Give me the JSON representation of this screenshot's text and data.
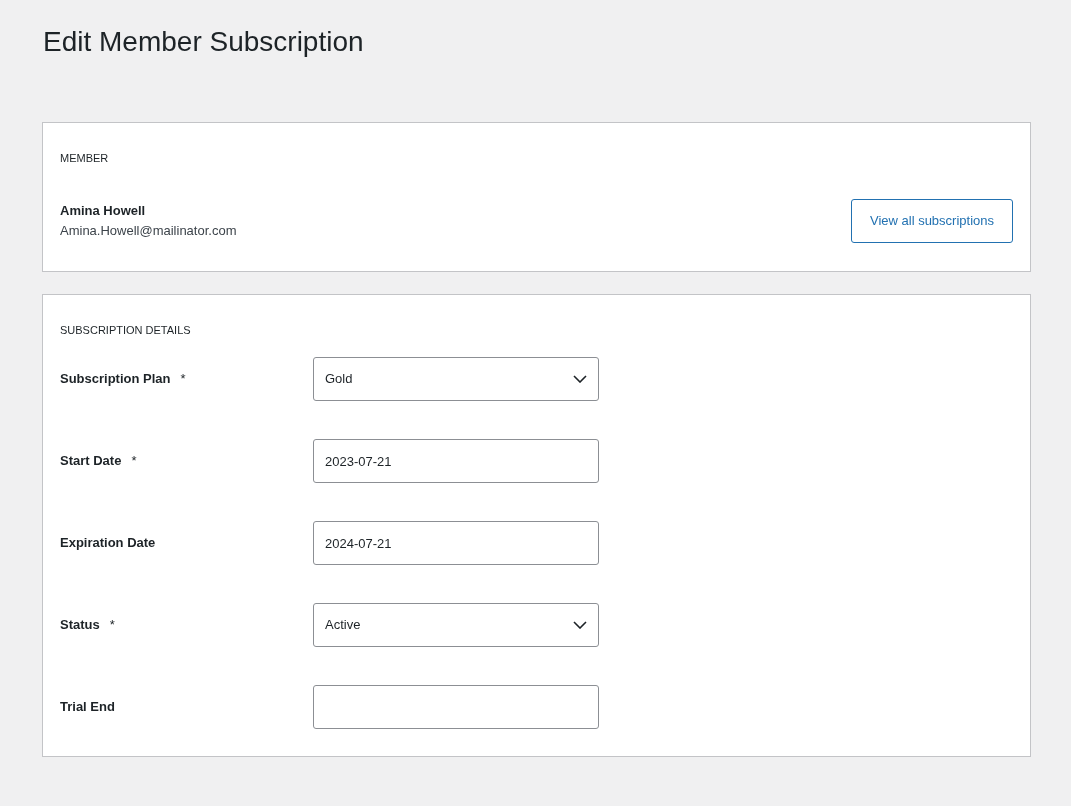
{
  "page_title": "Edit Member Subscription",
  "member": {
    "heading": "MEMBER",
    "name": "Amina Howell",
    "email": "Amina.Howell@mailinator.com",
    "button": "View all subscriptions"
  },
  "details": {
    "heading": "SUBSCRIPTION DETAILS",
    "required_mark": "*",
    "fields": [
      {
        "label": "Subscription Plan",
        "required": true,
        "kind": "select",
        "value": "Gold"
      },
      {
        "label": "Start Date",
        "required": true,
        "kind": "text",
        "value": "2023-07-21"
      },
      {
        "label": "Expiration Date",
        "required": false,
        "kind": "text",
        "value": "2024-07-21"
      },
      {
        "label": "Status",
        "required": true,
        "kind": "select",
        "value": "Active"
      },
      {
        "label": "Trial End",
        "required": false,
        "kind": "text"
      }
    ]
  }
}
